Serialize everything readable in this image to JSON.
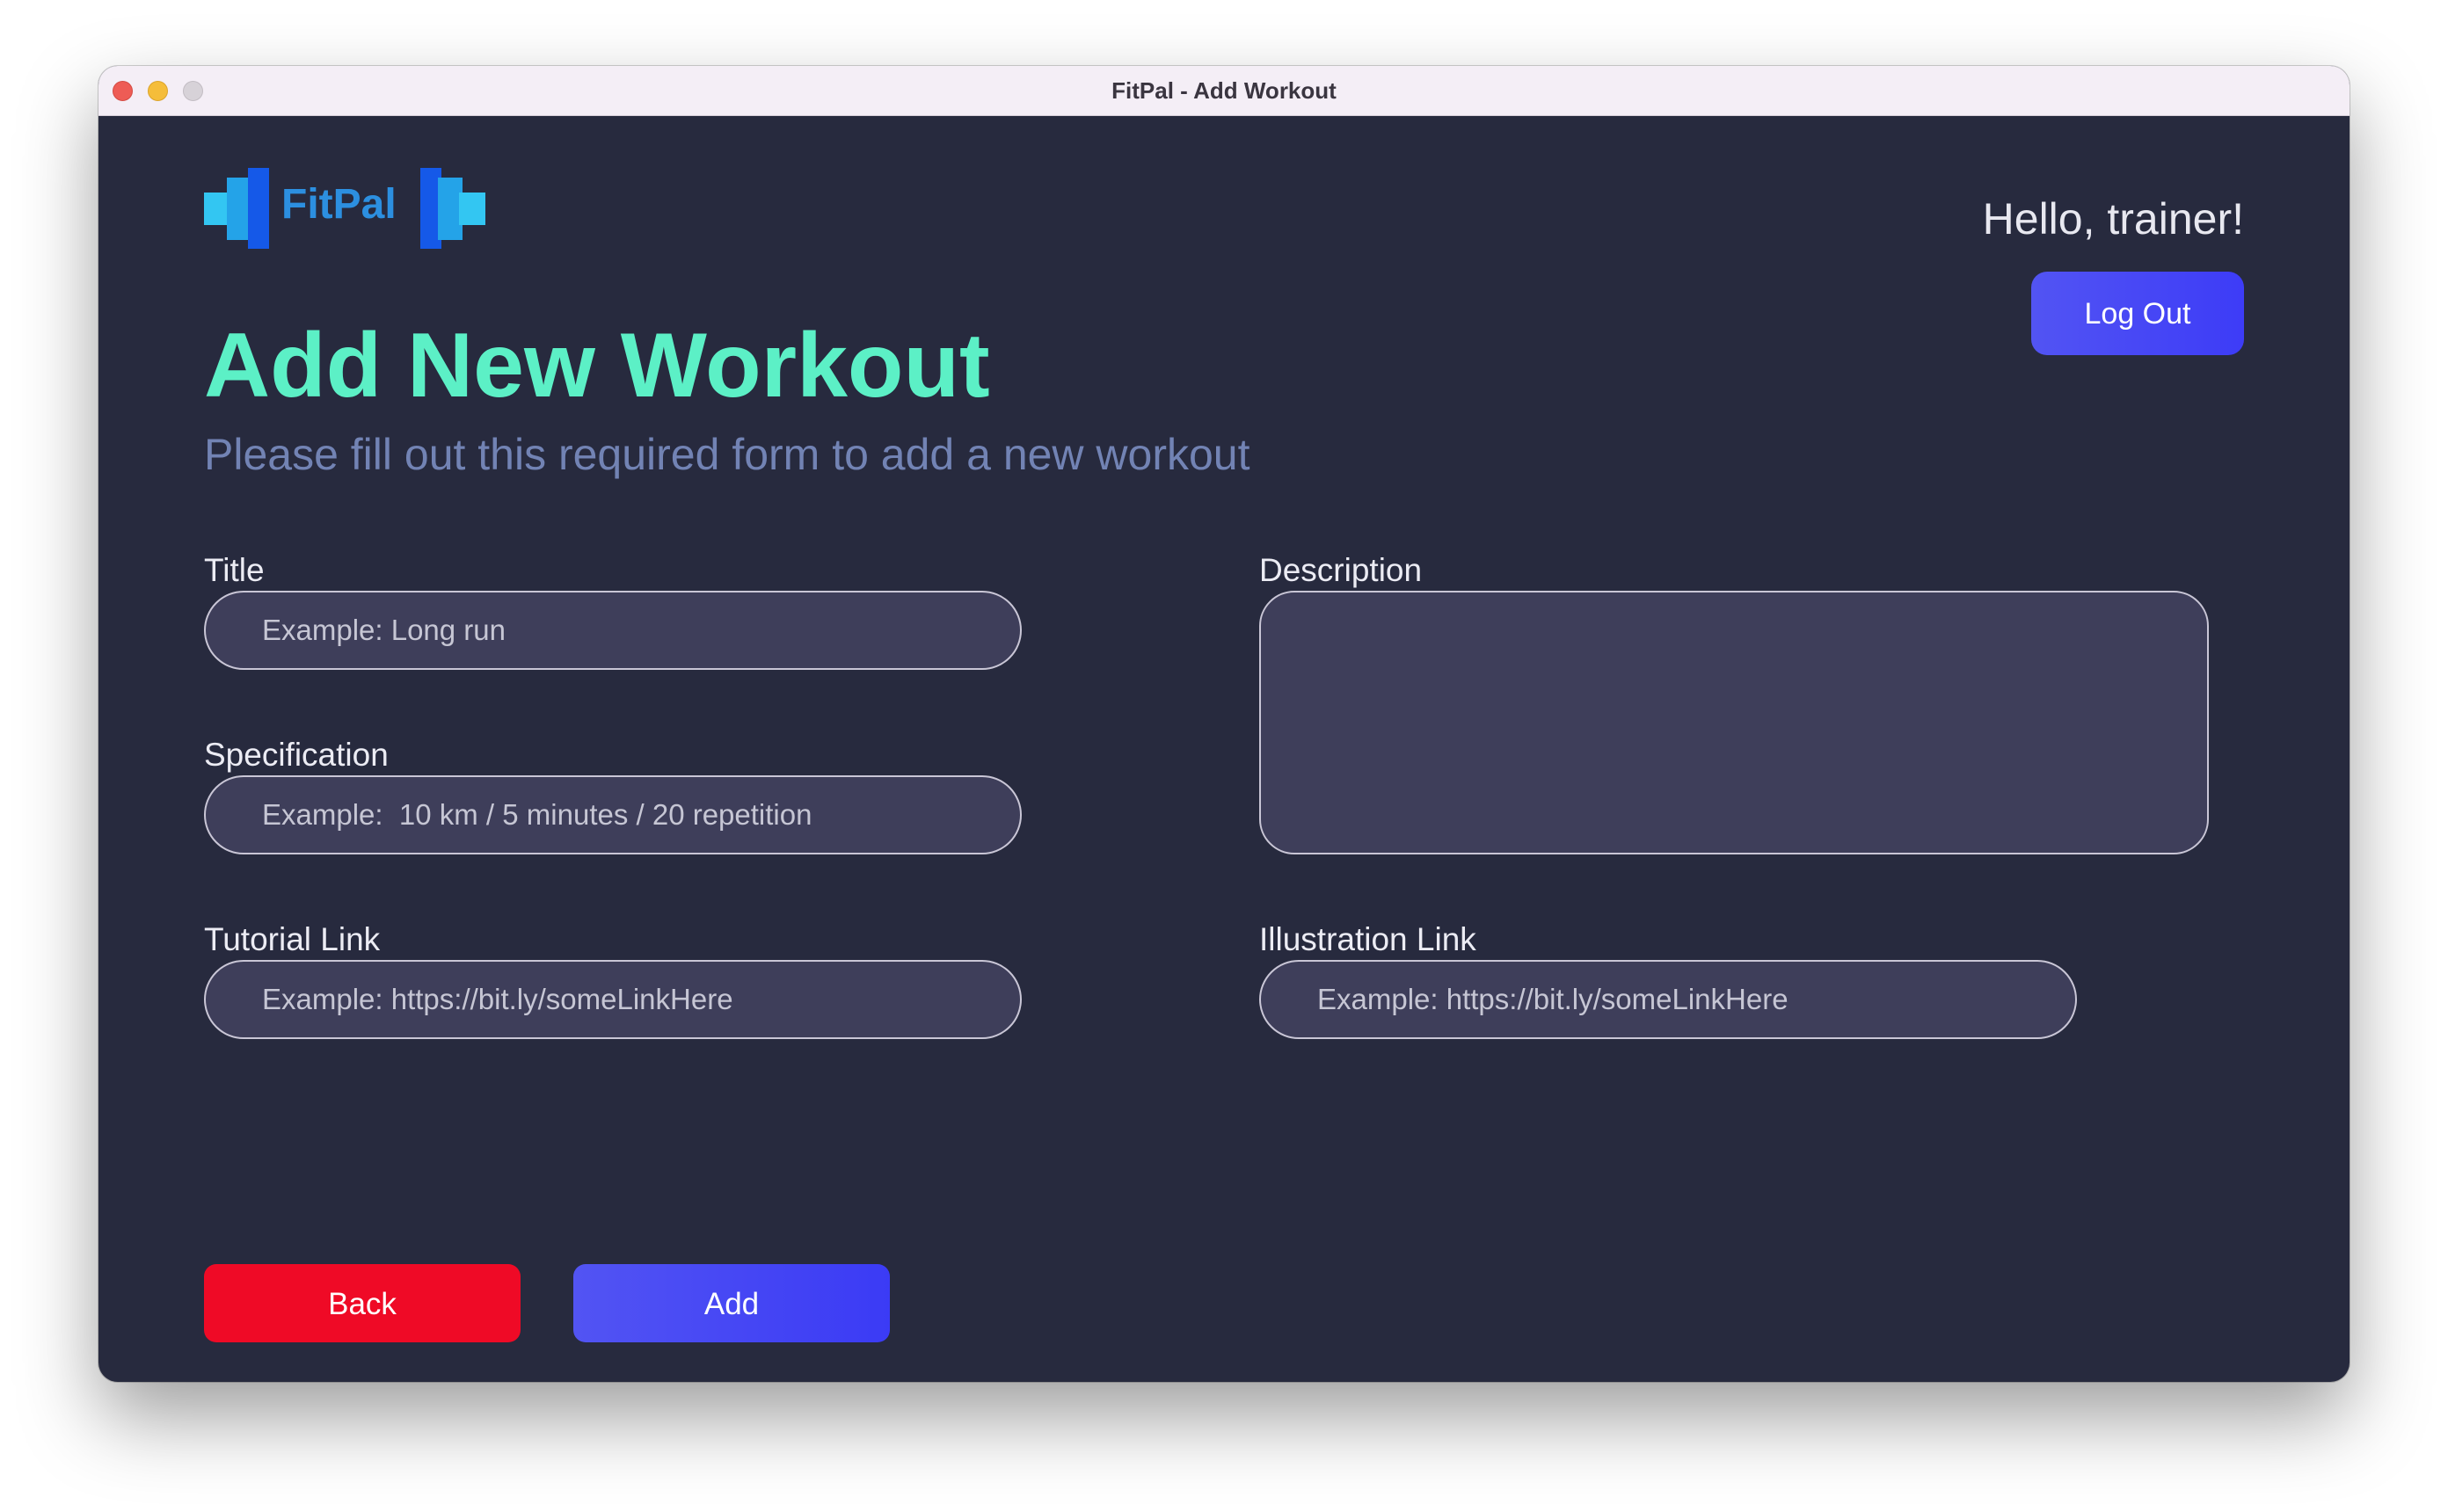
{
  "window": {
    "title": "FitPal - Add Workout"
  },
  "header": {
    "logo_text": "FitPal",
    "greeting": "Hello, trainer!",
    "logout_label": "Log Out"
  },
  "page": {
    "title": "Add New Workout",
    "subtitle": "Please fill out this required form to add a new workout"
  },
  "form": {
    "title": {
      "label": "Title",
      "value": "",
      "placeholder": "Example: Long run"
    },
    "specification": {
      "label": "Specification",
      "value": "",
      "placeholder": "Example:  10 km / 5 minutes / 20 repetition"
    },
    "tutorial_link": {
      "label": "Tutorial Link",
      "value": "",
      "placeholder": "Example: https://bit.ly/someLinkHere"
    },
    "description": {
      "label": "Description",
      "value": "",
      "placeholder": ""
    },
    "illustration_link": {
      "label": "Illustration Link",
      "value": "",
      "placeholder": "Example: https://bit.ly/someLinkHere"
    }
  },
  "actions": {
    "back_label": "Back",
    "add_label": "Add"
  },
  "colors": {
    "background": "#272a3e",
    "accent_green": "#5cf0c6",
    "primary_blue": "#4b4cf5",
    "danger_red": "#ef0a26",
    "field_bg": "#3e3e5a",
    "subtitle": "#7283b4"
  },
  "icons": {
    "logo_mark": "dumbbell-bars-icon"
  }
}
